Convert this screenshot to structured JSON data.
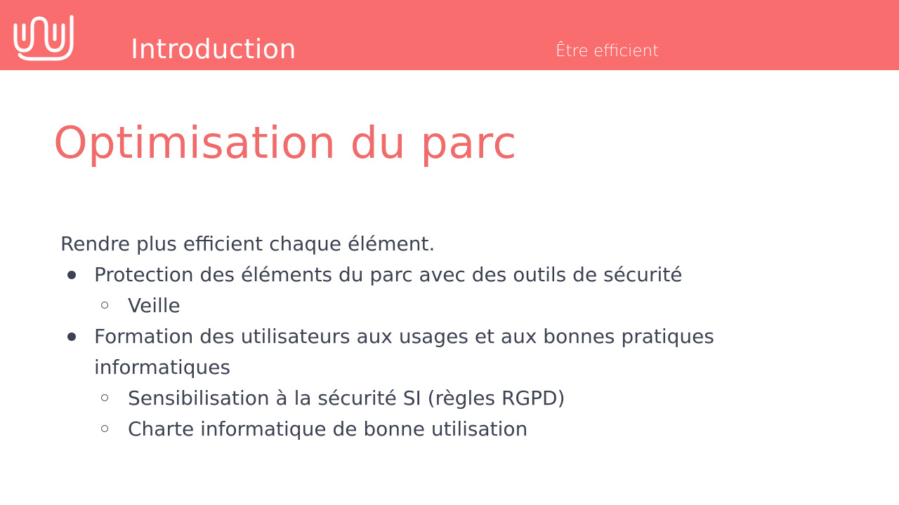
{
  "header": {
    "logo_icon": "wave-logo-icon",
    "section_title": "Introduction",
    "section_subtitle": "Être efficient",
    "background_color": "#f96d6f"
  },
  "slide": {
    "title": "Optimisation du parc",
    "title_color": "#f06b6c",
    "intro": "Rendre plus efficient chaque élément.",
    "items": [
      {
        "text": "Protection des éléments du parc avec des outils de sécurité",
        "subitems": [
          "Veille"
        ]
      },
      {
        "text": "Formation des utilisateurs aux usages et aux bonnes pratiques informatiques",
        "subitems": [
          "Sensibilisation à la sécurité SI (règles RGPD)",
          "Charte informatique de bonne utilisation"
        ]
      }
    ]
  }
}
